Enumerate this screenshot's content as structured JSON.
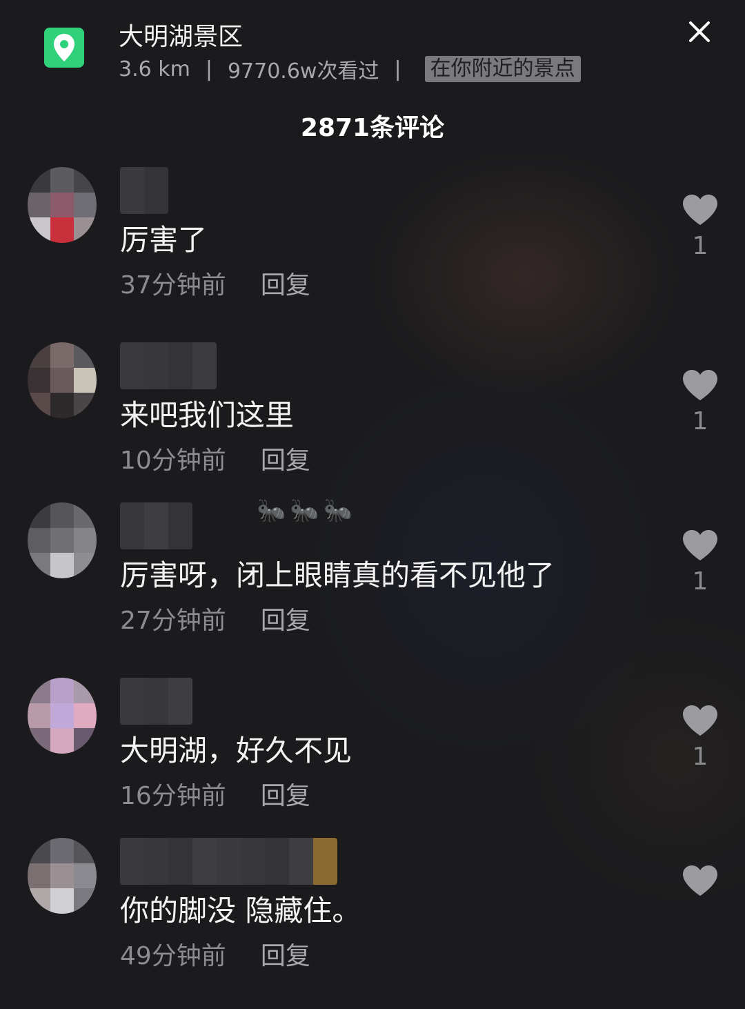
{
  "header": {
    "title": "大明湖景区",
    "distance": "3.6 km",
    "separator": "|",
    "views": "9770.6w次看过",
    "nearby_tag": "在你附近的景点",
    "location_icon": "location-pin-icon",
    "close_icon": "close-icon"
  },
  "comments_count": "2871条评论",
  "comments": [
    {
      "text": "厉害了",
      "time": "37分钟前",
      "reply": "回复",
      "likes": "1"
    },
    {
      "text": "来吧我们这里",
      "time": "10分钟前",
      "reply": "回复",
      "likes": "1"
    },
    {
      "text": "厉害呀，闭上眼睛真的看不见他了",
      "time": "27分钟前",
      "reply": "回复",
      "likes": "1",
      "decoration": "🐜🐜🐜"
    },
    {
      "text": "大明湖，好久不见",
      "time": "16分钟前",
      "reply": "回复",
      "likes": "1"
    },
    {
      "text": "你的脚没 隐藏住。",
      "time": "49分钟前",
      "reply": "回复",
      "likes": ""
    }
  ],
  "colors": {
    "accent_green": "#2fd17a",
    "background": "#1b1b1d",
    "muted_text": "#8c8c90"
  }
}
